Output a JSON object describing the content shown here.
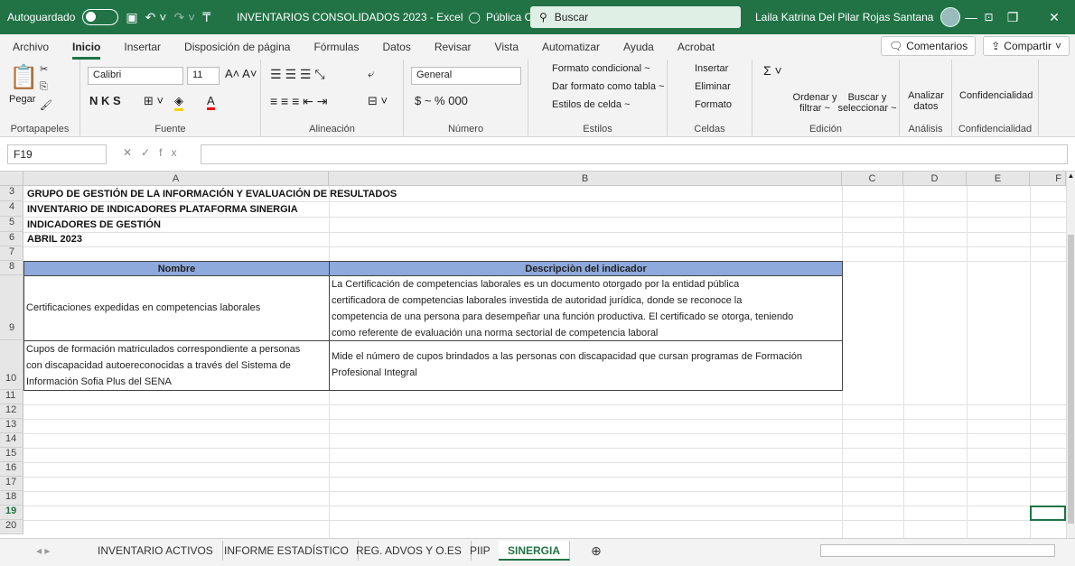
{
  "titlebar": {
    "autosave": "Autoguardado",
    "title": "INVENTARIOS CONSOLIDADOS 2023  -  Excel",
    "label": "Pública Clasificada",
    "search": "Buscar",
    "user": "Laila Katrina Del Pilar Rojas Santana"
  },
  "menu": [
    "Archivo",
    "Inicio",
    "Insertar",
    "Disposición de página",
    "Fórmulas",
    "Datos",
    "Revisar",
    "Vista",
    "Automatizar",
    "Ayuda",
    "Acrobat"
  ],
  "menu_right": {
    "comments": "Comentarios",
    "share": "Compartir"
  },
  "ribbon": {
    "paste": "Pegar",
    "font_name": "Calibri",
    "font_size": "11",
    "font_buttons": "N  K  S",
    "number_format": "General",
    "number_symbols": "$  ~  %  000",
    "cond_format": "Formato condicional ~",
    "table_format": "Dar formato como tabla ~",
    "cell_styles": "Estilos de celda ~",
    "insert": "Insertar",
    "delete": "Eliminar",
    "format": "Formato",
    "sort": "Ordenar y filtrar ~",
    "find": "Buscar y seleccionar ~",
    "analyze": "Analizar datos",
    "confidential": "Confidencialidad",
    "groups": [
      "Portapapeles",
      "Fuente",
      "Alineación",
      "Número",
      "Estilos",
      "Celdas",
      "Edición",
      "Análisis",
      "Confidencialidad"
    ]
  },
  "formula_bar": {
    "cell_ref": "F19",
    "content": ""
  },
  "columns": [
    "A",
    "B",
    "C",
    "D",
    "E",
    "F"
  ],
  "rows": {
    "r3": "GRUPO DE GESTIÓN DE LA INFORMACIÓN Y EVALUACIÓN DE RESULTADOS",
    "r4": "INVENTARIO DE INDICADORES PLATAFORMA SINERGIA",
    "r5": "INDICADORES DE GESTIÓN",
    "r6": "ABRIL 2023",
    "row_numbers": [
      "3",
      "4",
      "5",
      "6",
      "7",
      "8",
      "9",
      "10",
      "11",
      "12",
      "13",
      "14",
      "15",
      "16",
      "17",
      "18",
      "19",
      "20"
    ]
  },
  "table": {
    "headers": [
      "Nombre",
      "Descripciòn del indicador"
    ],
    "rows": [
      {
        "name": "Certificaciones expedidas en competencias laborales",
        "desc": [
          "La Certificación de competencias laborales es un documento otorgado por la entidad pública",
          "certificadora de competencias laborales investida de autoridad jurídica, donde se reconoce la",
          "competencia de una persona para desempeñar una función productiva. El certificado se otorga, teniendo",
          "como referente de evaluación una norma sectorial de competencia laboral"
        ]
      },
      {
        "name": [
          "Cupos de formación matriculados correspondiente a personas",
          "con discapacidad autoereconocidas a través del Sistema de",
          "Información Sofia Plus del SENA"
        ],
        "desc": [
          "Mide el número de cupos brindados a las personas con discapacidad que cursan programas de Formación",
          "Profesional Integral"
        ]
      }
    ]
  },
  "sheets": [
    "INVENTARIO ACTIVOS",
    "INFORME ESTADÍSTICO",
    "REG. ADVOS Y O.ES",
    "PIIP",
    "SINERGIA"
  ],
  "active_sheet": "SINERGIA",
  "colors": {
    "excel_green": "#217346",
    "header_fill": "#8ea9db"
  }
}
